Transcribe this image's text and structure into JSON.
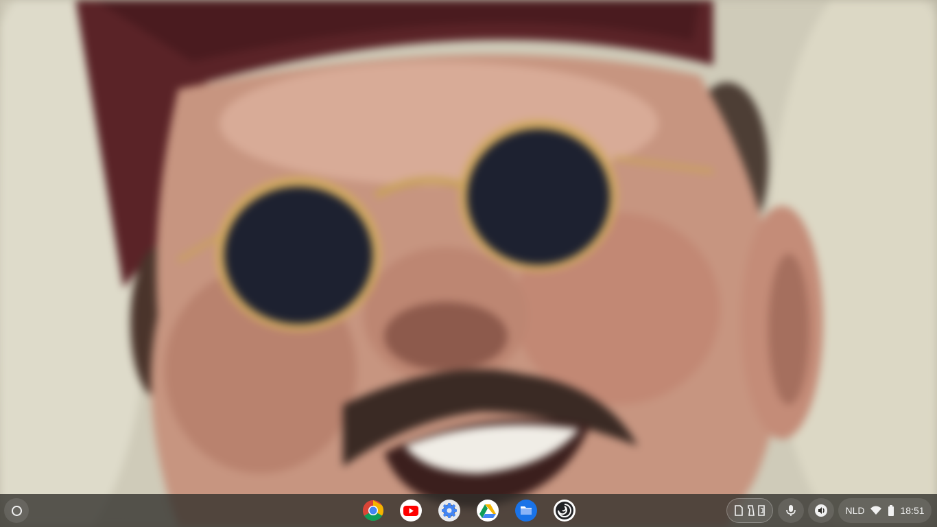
{
  "wallpaper": {
    "description_icon": "portrait-wallpaper"
  },
  "shelf": {
    "launcher_icon": "launcher-circle-icon",
    "apps": [
      {
        "name": "chrome",
        "icon": "chrome-icon"
      },
      {
        "name": "youtube",
        "icon": "youtube-icon"
      },
      {
        "name": "settings",
        "icon": "settings-gear-icon"
      },
      {
        "name": "drive",
        "icon": "google-drive-icon"
      },
      {
        "name": "files",
        "icon": "files-folder-icon"
      },
      {
        "name": "app-6",
        "icon": "swirl-app-icon"
      }
    ],
    "holding_space_icons": [
      "file-icon",
      "tote-icon",
      "trash-file-icon"
    ],
    "mic_icon": "microphone-icon",
    "accessibility_icon": "select-to-speak-icon",
    "status": {
      "ime": "NLD",
      "wifi_icon": "wifi-icon",
      "battery_icon": "battery-icon",
      "time": "18:51"
    }
  },
  "colors": {
    "shelf_bg": "#302e2a",
    "icon_fg": "#f1f1f1",
    "chrome_red": "#db4437",
    "chrome_yellow": "#f4b400",
    "chrome_green": "#0f9d58",
    "chrome_blue": "#4285f4",
    "youtube_red": "#ff0000",
    "files_blue": "#1a73e8"
  }
}
